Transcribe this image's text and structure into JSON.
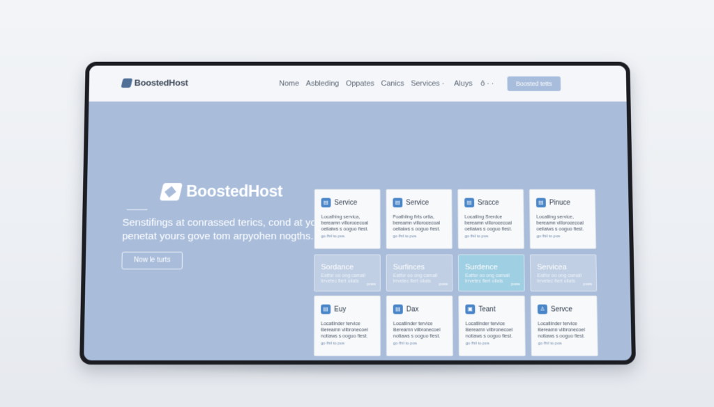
{
  "brand": {
    "name": "BoostedHost"
  },
  "nav": {
    "items": [
      "Nome",
      "Asbleding",
      "Oppates",
      "Canics",
      "Services ·"
    ],
    "right_items": [
      "Aluys",
      "ô ·  ·"
    ],
    "cta_label": "Boosted tetts"
  },
  "hero": {
    "logo_text": "BoostedHost",
    "headline_line1": "Senstifings at conrassed terics, cond at you",
    "headline_line2": "penetat yours gove tom arpyohen nogths.",
    "button_label": "Now le turts"
  },
  "cards_top": [
    {
      "icon": "▤",
      "title": "Service",
      "desc1": "Locathing servica,",
      "desc2": "bereamn villorocecoal",
      "desc3": "oeliaiws s ooguo fiest.",
      "link": "go fhil to pos"
    },
    {
      "icon": "▤",
      "title": "Service",
      "desc1": "Foathiing firts ortta,",
      "desc2": "bereamn villorocecoal",
      "desc3": "oeliaiws s ooguo fiest.",
      "link": "go fhil to pos"
    },
    {
      "icon": "▤",
      "title": "Sracce",
      "desc1": "Locatiing Srerdce",
      "desc2": "bereamn villorocecoal",
      "desc3": "oeliaiws s ooguo fiest.",
      "link": "go fhil to pos"
    },
    {
      "icon": "▤",
      "title": "Pinuce",
      "desc1": "Locatiing service,",
      "desc2": "bereamn villorocecoal",
      "desc3": "oeliaiws s ooguo fiest.",
      "link": "go fhil to pos"
    }
  ],
  "bands": [
    {
      "title": "Sordance",
      "desc1": "Eatfor oo ong camall",
      "desc2": "lrrvetec fiert oliats",
      "link": "poss"
    },
    {
      "title": "Surfinces",
      "desc1": "Eatfor oo ong camall",
      "desc2": "lrrvetec fiert oliats",
      "link": "poss"
    },
    {
      "title": "Surdence",
      "desc1": "Eatfor oo ong camall",
      "desc2": "lrrvetec fiert oliats",
      "link": "poss"
    },
    {
      "title": "Servicea",
      "desc1": "Eatfor oo ong camall",
      "desc2": "lrrvetec fiert oliats",
      "link": "poss"
    }
  ],
  "cards_bottom": [
    {
      "icon": "▤",
      "title": "Euy",
      "desc1": "Locatiinder tervice",
      "desc2": "Bereamn vilbronecoel",
      "desc3": "notiaws s ooguo fiest.",
      "link": "go fhil to pos"
    },
    {
      "icon": "▤",
      "title": "Dax",
      "desc1": "Locatiinder tervice",
      "desc2": "Bereamn vilbronecoel",
      "desc3": "notiaws s ooguo fiest.",
      "link": "go fhil to pos"
    },
    {
      "icon": "▣",
      "title": "Teant",
      "desc1": "Locatiinder tervice",
      "desc2": "Bereamn vilbronecoel",
      "desc3": "notiaws s ooguo fiest.",
      "link": "go fhil to pos"
    },
    {
      "icon": "♙",
      "title": "Servce",
      "desc1": "Locatiinder tervice",
      "desc2": "Bereamn vilbronecoel",
      "desc3": "notiaws s ooguo fiest.",
      "link": "go fhil to pos"
    }
  ],
  "colors": {
    "accent": "#4a86c8",
    "screen_bg": "#a9bddb",
    "highlight": "#9fcfe3"
  }
}
